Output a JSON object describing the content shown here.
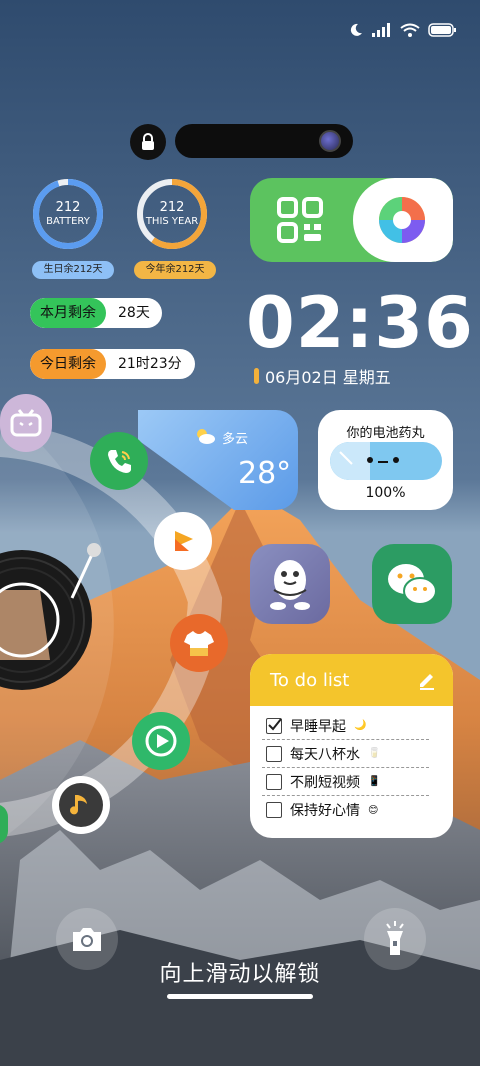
{
  "status_bar": {
    "icons": [
      "moon-icon",
      "signal-icon",
      "wifi-icon",
      "battery-icon"
    ]
  },
  "top": {
    "lock_icon": "lock-icon"
  },
  "rings": [
    {
      "number": "212",
      "label": "BATTERY",
      "tag": "生日余212天",
      "color": "#5b9cf0",
      "tag_color": "#8ec0f6",
      "progress": 0.95
    },
    {
      "number": "212",
      "label": "THIS YEAR",
      "tag": "今年余212天",
      "color": "#f3a53a",
      "tag_color": "#f3b645",
      "progress": 0.6
    }
  ],
  "counters": [
    {
      "label": "本月剩余",
      "value": "28天",
      "color": "#34c45a"
    },
    {
      "label": "今日剩余",
      "value": "21时23分",
      "color": "#f59a2e"
    }
  ],
  "quick_actions": {
    "left_icon": "qr-scan-icon",
    "right_icon": "camera-aperture-icon"
  },
  "clock": {
    "time": "02:36",
    "date": "06月02日 星期五"
  },
  "weather": {
    "condition": "多云",
    "temperature": "28°"
  },
  "battery_widget": {
    "title": "你的电池药丸",
    "percent": "100%"
  },
  "apps": {
    "bilibili": "bilibili-icon",
    "phone": "phone-icon",
    "video": "video-app-icon",
    "shop": "shirt-icon",
    "tencent_video": "play-icon",
    "music": "music-note-icon",
    "qq": "qq-penguin-icon",
    "wechat": "wechat-icon"
  },
  "todo": {
    "title": "To do list",
    "items": [
      {
        "text": "早睡早起",
        "emoji": "🌙",
        "checked": true
      },
      {
        "text": "每天八杯水",
        "emoji": "🥛",
        "checked": false
      },
      {
        "text": "不刷短视频",
        "emoji": "📱",
        "checked": false
      },
      {
        "text": "保持好心情",
        "emoji": "😊",
        "checked": false
      }
    ]
  },
  "bottom": {
    "camera_icon": "camera-icon",
    "flashlight_icon": "flashlight-icon",
    "unlock_text": "向上滑动以解锁"
  }
}
